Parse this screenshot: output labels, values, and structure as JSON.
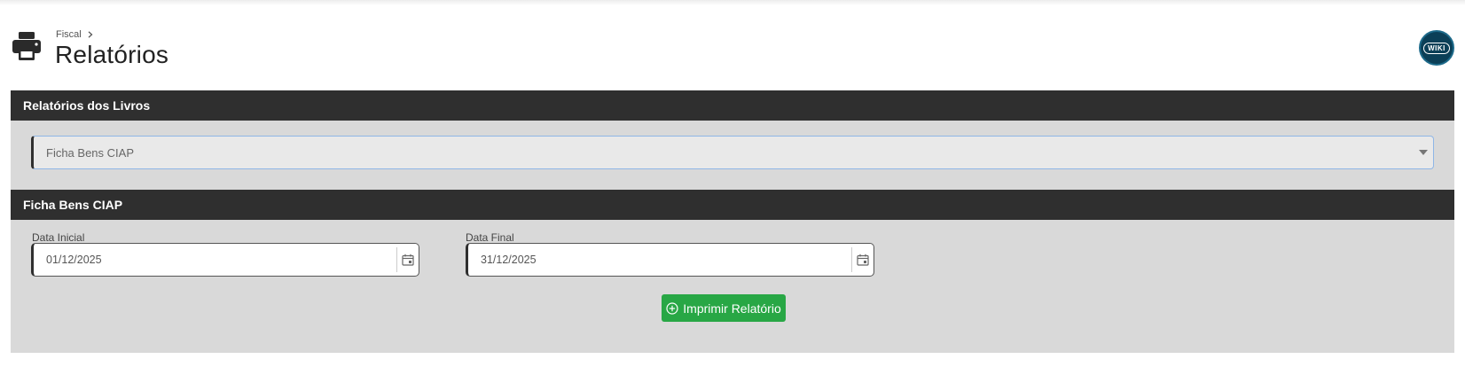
{
  "breadcrumb": {
    "parent": "Fiscal"
  },
  "page": {
    "title": "Relatórios"
  },
  "wiki": {
    "label": "WIKI"
  },
  "section_livros": {
    "title": "Relatórios dos Livros",
    "select_value": "Ficha Bens CIAP"
  },
  "section_ficha": {
    "title": "Ficha Bens CIAP",
    "data_inicial": {
      "label": "Data Inicial",
      "value": "01/12/2025"
    },
    "data_final": {
      "label": "Data Final",
      "value": "31/12/2025"
    },
    "print_button": "Imprimir Relatório"
  },
  "colors": {
    "section_header": "#2f2f2f",
    "panel_bg": "#d9d9d9",
    "button_green": "#28a745",
    "wiki_bg": "#0b3f57"
  }
}
